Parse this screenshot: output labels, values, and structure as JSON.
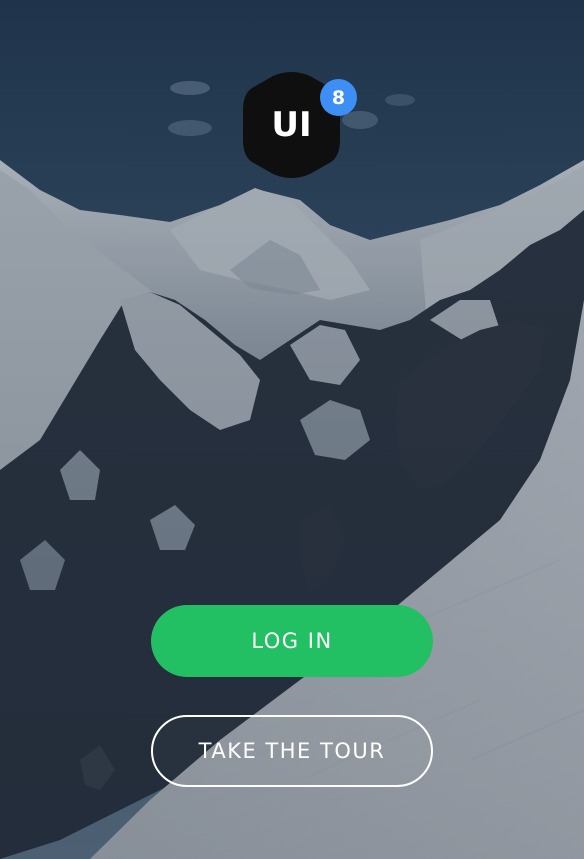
{
  "logo": {
    "text": "UI",
    "badge": "8",
    "icon": "hexagon-logo-icon"
  },
  "actions": {
    "login_label": "LOG IN",
    "tour_label": "TAKE THE TOUR"
  },
  "background": {
    "icon": "mountain-landscape-image"
  },
  "colors": {
    "primary_green": "#22c063",
    "badge_blue": "#3d8ef5",
    "logo_black": "#0f0f10"
  }
}
